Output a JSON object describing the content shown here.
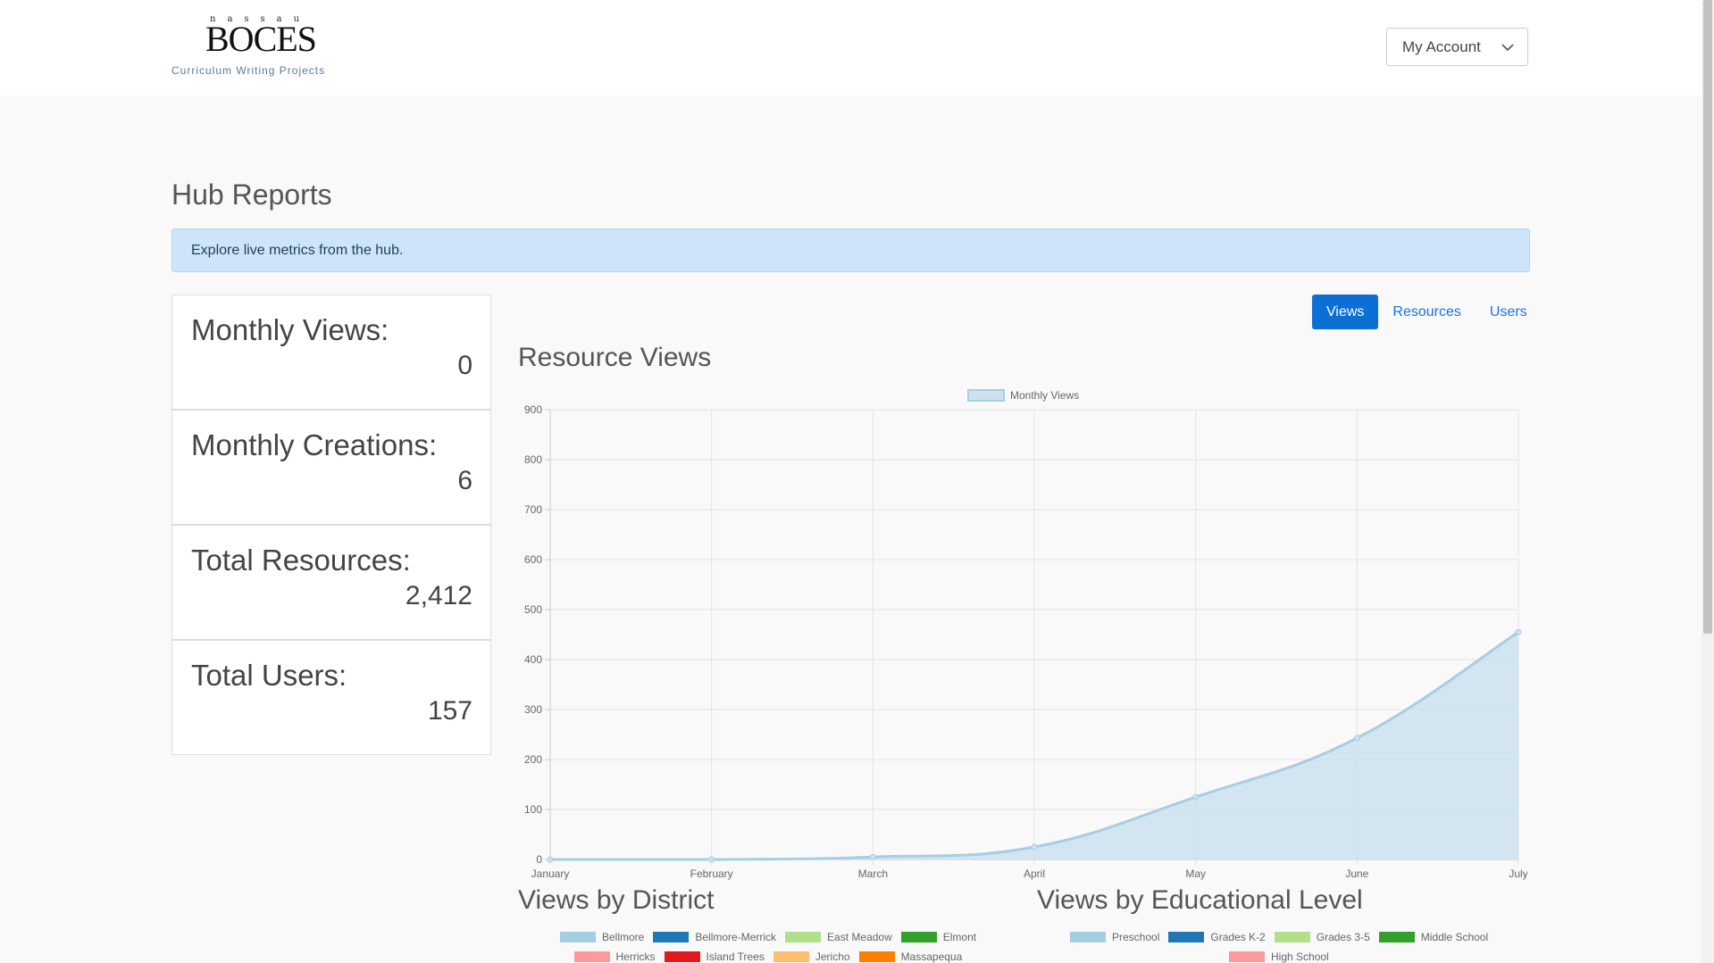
{
  "header": {
    "logo_small": "nassau",
    "logo_main": "BOCES",
    "logo_tagline": "Curriculum Writing Projects",
    "account_label": "My Account"
  },
  "page": {
    "title": "Hub Reports",
    "alert": "Explore live metrics from the hub."
  },
  "stats": [
    {
      "label": "Monthly Views:",
      "value": "0"
    },
    {
      "label": "Monthly Creations:",
      "value": "6"
    },
    {
      "label": "Total Resources:",
      "value": "2,412"
    },
    {
      "label": "Total Users:",
      "value": "157"
    }
  ],
  "tabs": [
    {
      "label": "Views",
      "active": true
    },
    {
      "label": "Resources",
      "active": false
    },
    {
      "label": "Users",
      "active": false
    }
  ],
  "sections": {
    "resource_views": "Resource Views",
    "views_by_district": "Views by District",
    "views_by_level": "Views by Educational Level"
  },
  "colors": {
    "accent": "#0b6fd6",
    "line": "#a6cee3",
    "fill": "#cde2ee"
  },
  "chart_data": [
    {
      "type": "area",
      "title": "Resource Views",
      "legend": [
        "Monthly Views"
      ],
      "legend_position": "top",
      "categories": [
        "January",
        "February",
        "March",
        "April",
        "May",
        "June",
        "July"
      ],
      "series": [
        {
          "name": "Monthly Views",
          "values": [
            0,
            0,
            5,
            25,
            125,
            243,
            455
          ]
        }
      ],
      "ylim": [
        0,
        900
      ],
      "yticks": [
        0,
        100,
        200,
        300,
        400,
        500,
        600,
        700,
        800,
        900
      ],
      "grid": true
    },
    {
      "type": "pie",
      "title": "Views by District",
      "legend": [
        {
          "name": "Bellmore",
          "color": "#a6cee3"
        },
        {
          "name": "Bellmore-Merrick",
          "color": "#1f78b4"
        },
        {
          "name": "East Meadow",
          "color": "#b2df8a"
        },
        {
          "name": "Elmont",
          "color": "#33a02c"
        },
        {
          "name": "Herricks",
          "color": "#fb9a99"
        },
        {
          "name": "Island Trees",
          "color": "#e31a1c"
        },
        {
          "name": "Jericho",
          "color": "#fdbf6f"
        },
        {
          "name": "Massapequa",
          "color": "#ff7f00"
        }
      ]
    },
    {
      "type": "pie",
      "title": "Views by Educational Level",
      "legend": [
        {
          "name": "Preschool",
          "color": "#a6cee3"
        },
        {
          "name": "Grades K-2",
          "color": "#1f78b4"
        },
        {
          "name": "Grades 3-5",
          "color": "#b2df8a"
        },
        {
          "name": "Middle School",
          "color": "#33a02c"
        },
        {
          "name": "High School",
          "color": "#fb9a99"
        }
      ]
    }
  ]
}
